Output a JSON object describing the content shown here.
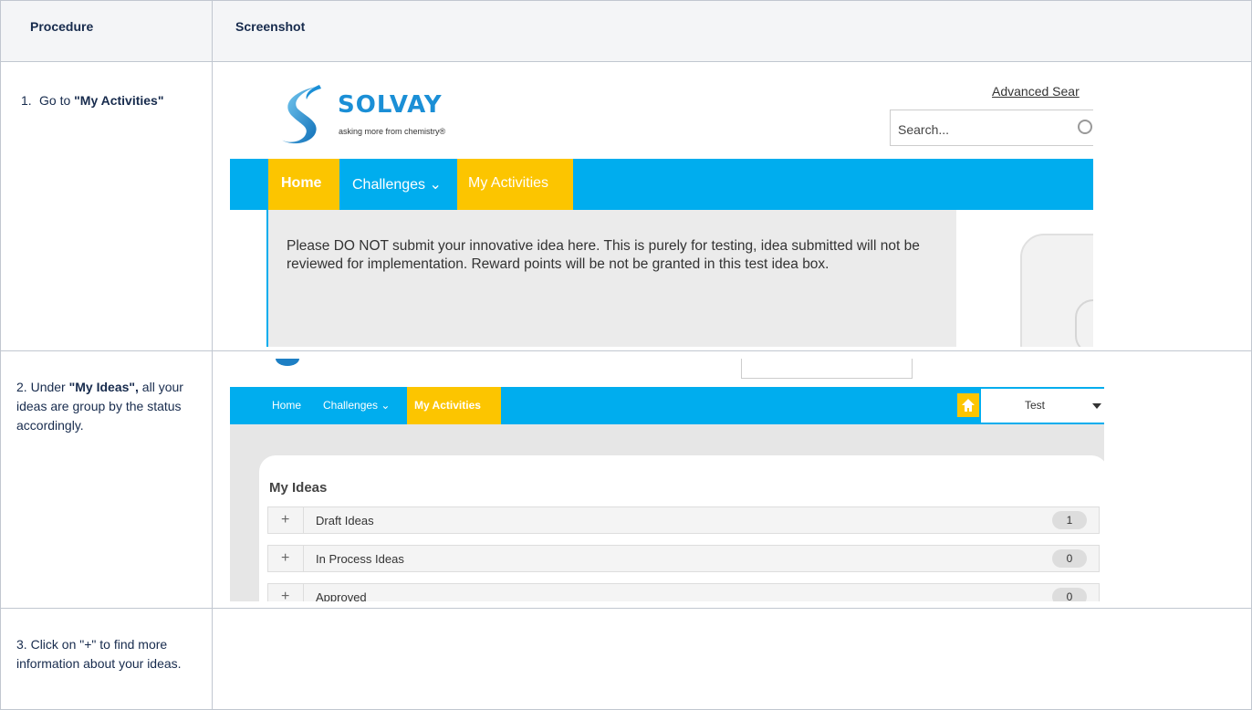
{
  "table": {
    "headers": {
      "procedure": "Procedure",
      "screenshot": "Screenshot"
    },
    "rows": [
      {
        "step_num": "1.",
        "step_pre": "Go to ",
        "step_bold": "\"My Activities\"",
        "step_post": ""
      },
      {
        "step_num": "2.",
        "step_pre": "Under ",
        "step_bold": "\"My Ideas\",",
        "step_post": " all your ideas are group by the status accordingly."
      },
      {
        "step_num": "3.",
        "step_pre": "Click on \"+\" to find more information about your ideas.",
        "step_bold": "",
        "step_post": ""
      }
    ]
  },
  "screenshot1": {
    "brand": "SOLVAY",
    "tagline": "asking more from chemistry®",
    "advanced_search": "Advanced Sear",
    "search_placeholder": "Search...",
    "nav": {
      "home": "Home",
      "challenges": "Challenges ⌄",
      "my_activities": "My Activities"
    },
    "notice": "Please DO NOT submit your innovative idea here.  This is purely for testing, idea submitted will not be reviewed for implementation. Reward points will be not be granted in this test idea box.",
    "colors": {
      "nav": "#00adee",
      "highlight": "#fcc500",
      "brand": "#1b8fd6"
    }
  },
  "screenshot2": {
    "nav": {
      "home": "Home",
      "challenges": "Challenges ⌄",
      "my_activities": "My Activities",
      "user": "Test"
    },
    "section_title": "My Ideas",
    "idea_groups": [
      {
        "plus": "+",
        "label": "Draft Ideas",
        "count": "1"
      },
      {
        "plus": "+",
        "label": "In Process Ideas",
        "count": "0"
      },
      {
        "plus": "+",
        "label": "Approved",
        "count": "0"
      }
    ]
  }
}
